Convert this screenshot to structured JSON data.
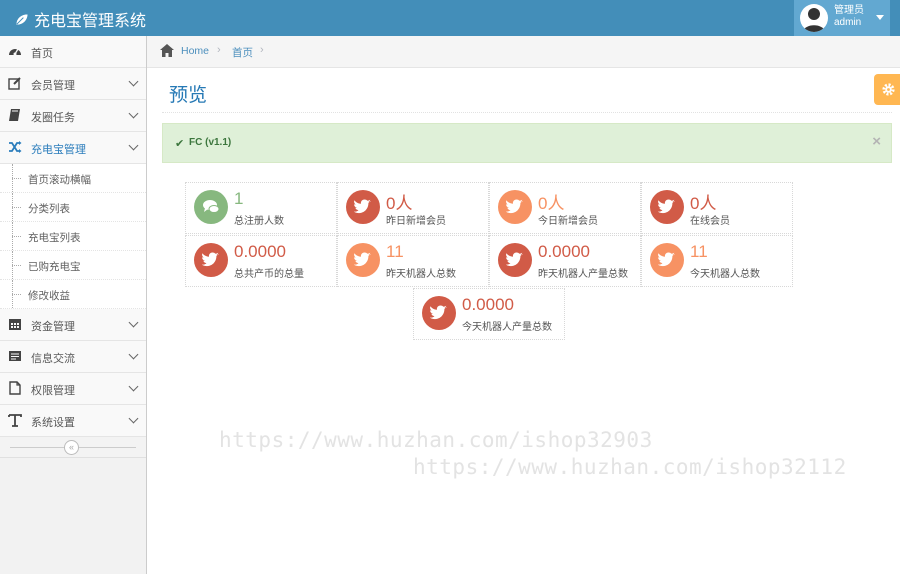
{
  "app": {
    "title": "充电宝管理系统"
  },
  "user": {
    "role": "管理员",
    "name": "admin"
  },
  "sidebar": {
    "items": [
      {
        "label": "首页",
        "icon": "dashboard-icon"
      },
      {
        "label": "会员管理",
        "icon": "edit-icon"
      },
      {
        "label": "发圈任务",
        "icon": "book-icon"
      },
      {
        "label": "充电宝管理",
        "icon": "random-icon"
      },
      {
        "label": "资金管理",
        "icon": "calendar-icon"
      },
      {
        "label": "信息交流",
        "icon": "list-icon"
      },
      {
        "label": "权限管理",
        "icon": "file-icon"
      },
      {
        "label": "系统设置",
        "icon": "text-icon"
      }
    ],
    "submenu": [
      "首页滚动横幅",
      "分类列表",
      "充电宝列表",
      "已购充电宝",
      "修改收益"
    ]
  },
  "breadcrumb": {
    "home": "Home",
    "current": "首页"
  },
  "page": {
    "title": "预览"
  },
  "alert": {
    "text": "FC (v1.1)"
  },
  "stats": [
    {
      "value": "1",
      "label": "总注册人数",
      "color": "#87b87f",
      "icon": "comments-icon"
    },
    {
      "value": "0人",
      "label": "昨日新增会员",
      "color": "#d15b47",
      "icon": "twitter-icon"
    },
    {
      "value": "0人",
      "label": "今日新增会员",
      "color": "#f79263",
      "icon": "twitter-icon"
    },
    {
      "value": "0人",
      "label": "在线会员",
      "color": "#d15b47",
      "icon": "twitter-icon"
    },
    {
      "value": "0.0000",
      "label": "总共产币的总量",
      "color": "#d15b47",
      "icon": "twitter-icon"
    },
    {
      "value": "11",
      "label": "昨天机器人总数",
      "color": "#f79263",
      "icon": "twitter-icon"
    },
    {
      "value": "0.0000",
      "label": "昨天机器人产量总数",
      "color": "#d15b47",
      "icon": "twitter-icon"
    },
    {
      "value": "11",
      "label": "今天机器人总数",
      "color": "#f79263",
      "icon": "twitter-icon"
    },
    {
      "value": "0.0000",
      "label": "今天机器人产量总数",
      "color": "#d15b47",
      "icon": "twitter-icon"
    }
  ],
  "watermarks": [
    "https://www.huzhan.com/ishop32903",
    "https://www.huzhan.com/ishop32112"
  ],
  "colors": {
    "navbar": "#438eb9",
    "user_box": "#62a8d1",
    "link": "#2679b5",
    "settings": "#ffb752"
  }
}
